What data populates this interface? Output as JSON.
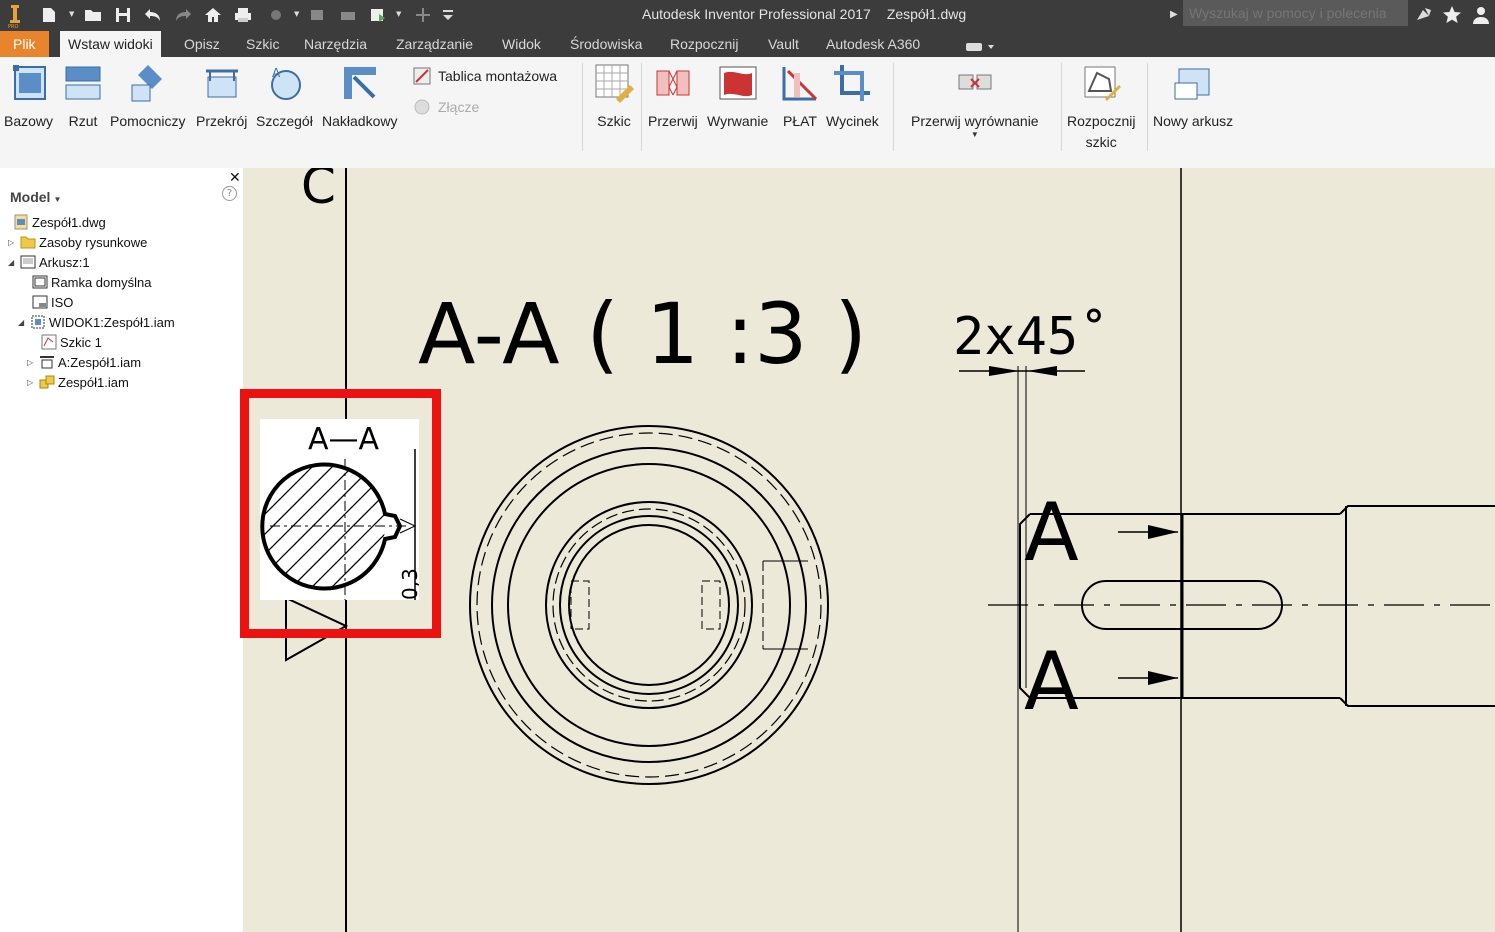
{
  "app": {
    "title": "Autodesk Inventor Professional 2017",
    "document": "Zespół1.dwg"
  },
  "search": {
    "placeholder": "Wyszukaj w pomocy i polecenia"
  },
  "tabs": [
    {
      "label": "Plik"
    },
    {
      "label": "Wstaw widoki"
    },
    {
      "label": "Opisz"
    },
    {
      "label": "Szkic"
    },
    {
      "label": "Narzędzia"
    },
    {
      "label": "Zarządzanie"
    },
    {
      "label": "Widok"
    },
    {
      "label": "Środowiska"
    },
    {
      "label": "Rozpocznij"
    },
    {
      "label": "Vault"
    },
    {
      "label": "Autodesk A360"
    }
  ],
  "ribbon": {
    "bazowy": "Bazowy",
    "rzut": "Rzut",
    "pomocniczy": "Pomocniczy",
    "przekroj": "Przekrój",
    "szczegol": "Szczegół",
    "nakladkowy": "Nakładkowy",
    "tablica": "Tablica montażowa",
    "zlacze": "Złącze",
    "szkic": "Szkic",
    "przerwij": "Przerwij",
    "wyrwanie": "Wyrwanie",
    "plat": "PŁAT",
    "wycinek": "Wycinek",
    "przerwij_wyrownanie": "Przerwij wyrównanie",
    "rozpocznij_szkic_1": "Rozpocznij",
    "rozpocznij_szkic_2": "szkic",
    "nowy_arkusz": "Nowy arkusz"
  },
  "browser": {
    "header": "Model",
    "items": [
      {
        "label": "Zespół1.dwg"
      },
      {
        "label": "Zasoby rysunkowe"
      },
      {
        "label": "Arkusz:1"
      },
      {
        "label": "Ramka domyślna"
      },
      {
        "label": "ISO"
      },
      {
        "label": "WIDOK1:Zespół1.iam"
      },
      {
        "label": "Szkic 1"
      },
      {
        "label": "A:Zespół1.iam"
      },
      {
        "label": "Zespół1.iam"
      }
    ]
  },
  "drawing": {
    "zone_letter": "C",
    "view_label": "A-A ( 1 :3 )",
    "chamfer": "2x45˚",
    "section_letter_top": "A",
    "section_letter_bottom": "A",
    "inset_label": "A—A",
    "inset_dim": "0,3"
  },
  "colors": {
    "accent_file_tab": "#e8842b",
    "highlight": "#ee1111",
    "canvas": "#ece9d8"
  }
}
